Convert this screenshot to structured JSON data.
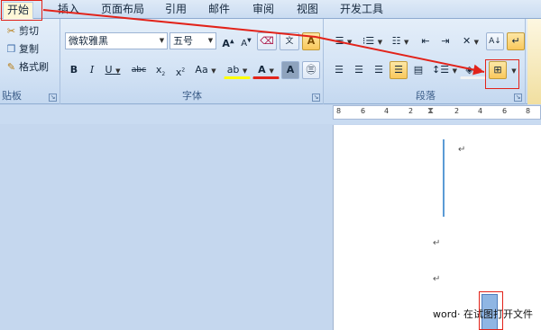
{
  "tabs": [
    "开始",
    "插入",
    "页面布局",
    "引用",
    "邮件",
    "审阅",
    "视图",
    "开发工具"
  ],
  "clipboard": {
    "cut": "剪切",
    "copy": "复制",
    "format_painter": "格式刷",
    "label": "贴板"
  },
  "font": {
    "name": "微软雅黑",
    "size": "五号",
    "label": "字体"
  },
  "paragraph": {
    "label": "段落"
  },
  "ruler": {
    "ticks": [
      "8",
      "6",
      "4",
      "2",
      "2",
      "4",
      "6",
      "8"
    ]
  },
  "document": {
    "mark": "↵",
    "text": "word· 在试图打开文件"
  },
  "colors": {
    "highlight": "#e2231a",
    "arrow": "#e2231a",
    "accent": "#f9c85c"
  }
}
